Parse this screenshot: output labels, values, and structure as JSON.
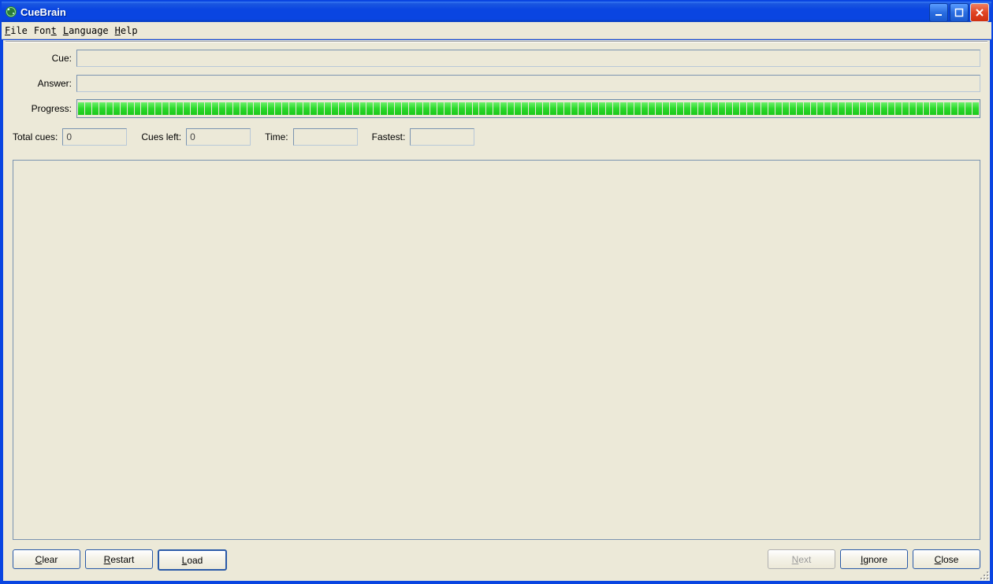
{
  "window": {
    "title": "CueBrain"
  },
  "menu": {
    "file": "File",
    "font": "Font",
    "language": "Language",
    "help": "Help"
  },
  "labels": {
    "cue": "Cue:",
    "answer": "Answer:",
    "progress": "Progress:",
    "total_cues": "Total cues:",
    "cues_left": "Cues left:",
    "time": "Time:",
    "fastest": "Fastest:"
  },
  "fields": {
    "cue": "",
    "answer": "",
    "total_cues": "0",
    "cues_left": "0",
    "time": "",
    "fastest": ""
  },
  "progress": {
    "percent": 100
  },
  "buttons": {
    "clear": "Clear",
    "restart": "Restart",
    "load": "Load",
    "next": "Next",
    "ignore": "Ignore",
    "close": "Close"
  },
  "buttons_state": {
    "next_disabled": true
  }
}
